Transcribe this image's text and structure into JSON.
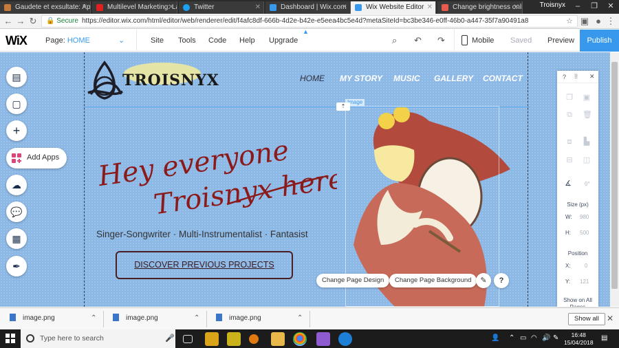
{
  "browser": {
    "tabs": [
      {
        "title": "Gaudete et exsultate: Ap",
        "color": "#c47a3a"
      },
      {
        "title": "Multilevel Marketing: La",
        "color": "#e02020"
      },
      {
        "title": "Twitter",
        "color": "#1da1f2"
      },
      {
        "title": "Dashboard | Wix.com",
        "color": "#3899ec"
      },
      {
        "title": "Wix Website Editor",
        "color": "#3899ec"
      },
      {
        "title": "Change brightness onli",
        "color": "#e85a4f"
      }
    ],
    "profile": "Troisnyx",
    "secure_label": "Secure",
    "url": "https://editor.wix.com/html/editor/web/renderer/edit/f4afc8df-666b-4d2e-b42e-e5eea4bc5e4d?metaSiteId=bc3be346-e0ff-46b0-a447-35f7a90491a8"
  },
  "wix": {
    "logo": "WiX",
    "page_label": "Page:",
    "page_value": "HOME",
    "menu": [
      "Site",
      "Tools",
      "Code",
      "Help",
      "Upgrade"
    ],
    "mobile_label": "Mobile",
    "saved_label": "Saved",
    "preview_label": "Preview",
    "publish_label": "Publish",
    "add_apps_label": "Add Apps",
    "image_label": "Image",
    "change_design": "Change Page Design",
    "change_background": "Change Page Background",
    "help_glyph": "?",
    "accent": "#3899ec"
  },
  "site": {
    "brand": "TROISNYX",
    "nav": [
      "HOME",
      "MY STORY",
      "MUSIC",
      "GALLERY",
      "CONTACT"
    ],
    "headline_line1": "Hey everyone",
    "headline_line2": "Troisnyx here!",
    "tagline": "Singer-Songwriter · Multi-Instrumentalist · Fantasist",
    "cta": "DISCOVER PREVIOUS PROJECTS",
    "headline_color": "#8b1a1a"
  },
  "panel": {
    "help": "?",
    "size_label": "Size (px)",
    "w_label": "W:",
    "w_value": "980",
    "h_label": "H:",
    "h_value": "500",
    "rotate_value": "0°",
    "position_label": "Position",
    "x_label": "X:",
    "x_value": "0",
    "y_label": "Y:",
    "y_value": "121",
    "show_all_label": "Show on All Pages"
  },
  "downloads": {
    "items": [
      "image.png",
      "image.png",
      "image.png"
    ],
    "show_all": "Show all"
  },
  "taskbar": {
    "search_placeholder": "Type here to search",
    "time": "16:48",
    "date": "15/04/2018"
  }
}
